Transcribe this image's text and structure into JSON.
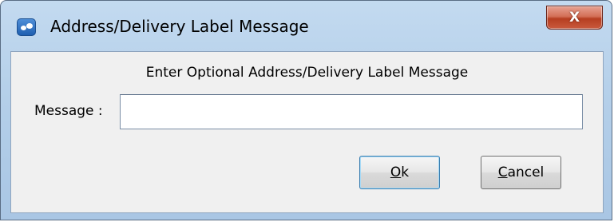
{
  "window": {
    "title": "Address/Delivery Label Message",
    "close_symbol": "X",
    "app_icon": "chat-bubbles-icon"
  },
  "dialog": {
    "prompt": "Enter Optional Address/Delivery Label Message",
    "message_label": "Message :",
    "message_value": "",
    "ok_mnemonic": "O",
    "ok_rest": "k",
    "cancel_mnemonic": "C",
    "cancel_rest": "ancel"
  },
  "colors": {
    "frame": "#b4cfe9",
    "client": "#f0f0f0",
    "close_button": "#c95a3d"
  }
}
